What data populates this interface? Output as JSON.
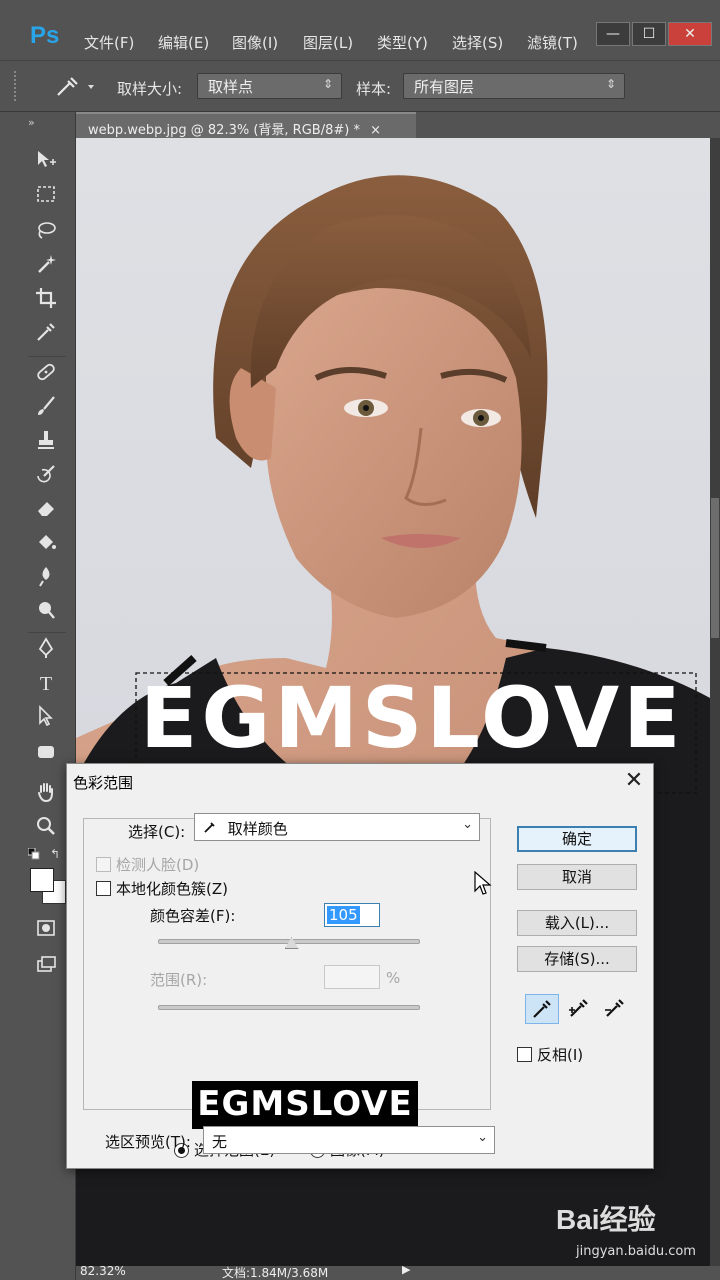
{
  "app": {
    "menu": [
      "文件(F)",
      "编辑(E)",
      "图像(I)",
      "图层(L)",
      "类型(Y)",
      "选择(S)",
      "滤镜(T)"
    ],
    "window_buttons": [
      "—",
      "☐",
      "✕"
    ]
  },
  "options_bar": {
    "sample_size_label": "取样大小:",
    "sample_size_value": "取样点",
    "sample_label": "样本:",
    "sample_value": "所有图层"
  },
  "document": {
    "tab_label": "webp.webp.jpg @ 82.3% (背景, RGB/8#) *",
    "tab_close": "×",
    "overlay_text": "EGMSLOVE"
  },
  "status_bar": {
    "zoom": "82.32%",
    "doc_info": "文档:1.84M/3.68M"
  },
  "dialog": {
    "title": "色彩范围",
    "close": "✕",
    "select_label": "选择(C):",
    "select_value": "取样颜色",
    "detect_faces": "检测人脸(D)",
    "localized_clusters": "本地化颜色簇(Z)",
    "fuzziness_label": "颜色容差(F):",
    "fuzziness_value": "105",
    "fuzziness_level": 0.51,
    "range_label": "范围(R):",
    "range_unit": "%",
    "preview_text": "EGMSLOVE",
    "radio_selection": "选择范围(E)",
    "radio_image": "图像(M)",
    "selection_preview_label": "选区预览(T):",
    "selection_preview_value": "无",
    "buttons": {
      "ok": "确定",
      "cancel": "取消",
      "load": "载入(L)...",
      "save": "存储(S)..."
    },
    "invert_label": "反相(I)"
  },
  "watermark": {
    "brand": "Bai经验",
    "url": "jingyan.baidu.com"
  }
}
